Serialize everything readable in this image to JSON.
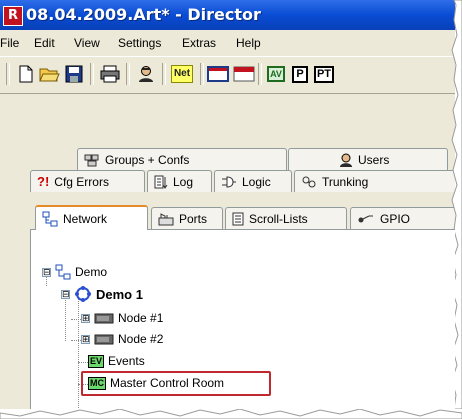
{
  "window": {
    "title": "08.04.2009.Art* - Director",
    "app_icon_letter": "R"
  },
  "menubar": {
    "items": [
      "File",
      "Edit",
      "View",
      "Settings",
      "Extras",
      "Help"
    ]
  },
  "toolbar": {
    "net_label": "Net",
    "av_label": "AV",
    "p_label": "P",
    "pt_label": "PT"
  },
  "tabs": {
    "row1": [
      {
        "label": "Groups + Confs",
        "icon": "groups-icon"
      },
      {
        "label": "Users",
        "icon": "users-icon"
      }
    ],
    "row2": [
      {
        "label": "Cfg Errors",
        "icon": "error-icon",
        "prefix": "?!"
      },
      {
        "label": "Log",
        "icon": "log-icon"
      },
      {
        "label": "Logic",
        "icon": "logic-icon"
      },
      {
        "label": "Trunking",
        "icon": "trunking-icon"
      }
    ],
    "row3": [
      {
        "label": "Network",
        "icon": "network-icon"
      },
      {
        "label": "Ports",
        "icon": "ports-icon"
      },
      {
        "label": "Scroll-Lists",
        "icon": "scroll-lists-icon"
      },
      {
        "label": "GPIO",
        "icon": "gpio-icon"
      }
    ]
  },
  "tree": {
    "root": {
      "label": "Demo",
      "expander": "⊟"
    },
    "demo1": {
      "label": "Demo 1",
      "expander": "⊟"
    },
    "node1": {
      "label": "Node #1",
      "expander": "⊞"
    },
    "node2": {
      "label": "Node #2",
      "expander": "⊞"
    },
    "events": {
      "label": "Events",
      "badge": "EV"
    },
    "mcr": {
      "label": "Master Control Room",
      "badge": "MC"
    }
  },
  "colors": {
    "title_bar": "#0a4cd4",
    "net_button": "#ffff66",
    "highlight": "#c0282f",
    "ev_badge": "#6bd96b",
    "mc_badge": "#6bd96b",
    "tab_active_accent": "#e68b2c"
  }
}
